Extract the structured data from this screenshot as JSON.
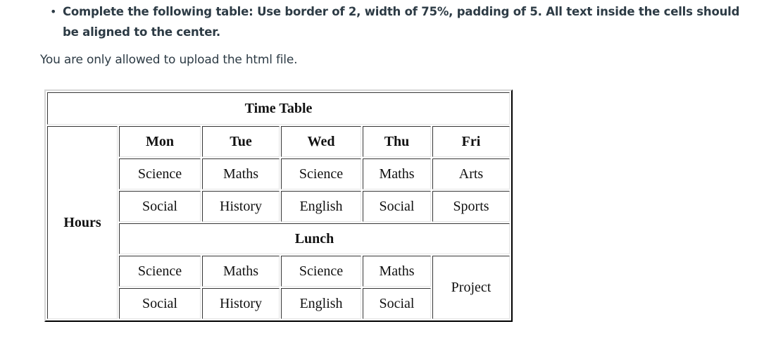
{
  "instructions": {
    "bullet": "•",
    "task": "Complete the following table: Use border of 2, width of 75%, padding of 5. All text inside the cells should be aligned to the center.",
    "note": "You are only allowed to upload the html file."
  },
  "timetable": {
    "title": "Time Table",
    "row_header": "Hours",
    "days": [
      "Mon",
      "Tue",
      "Wed",
      "Thu",
      "Fri"
    ],
    "morning": [
      [
        "Science",
        "Maths",
        "Science",
        "Maths",
        "Arts"
      ],
      [
        "Social",
        "History",
        "English",
        "Social",
        "Sports"
      ]
    ],
    "break_label": "Lunch",
    "afternoon": [
      [
        "Science",
        "Maths",
        "Science",
        "Maths"
      ],
      [
        "Social",
        "History",
        "English",
        "Social"
      ]
    ],
    "afternoon_fri": "Project"
  }
}
